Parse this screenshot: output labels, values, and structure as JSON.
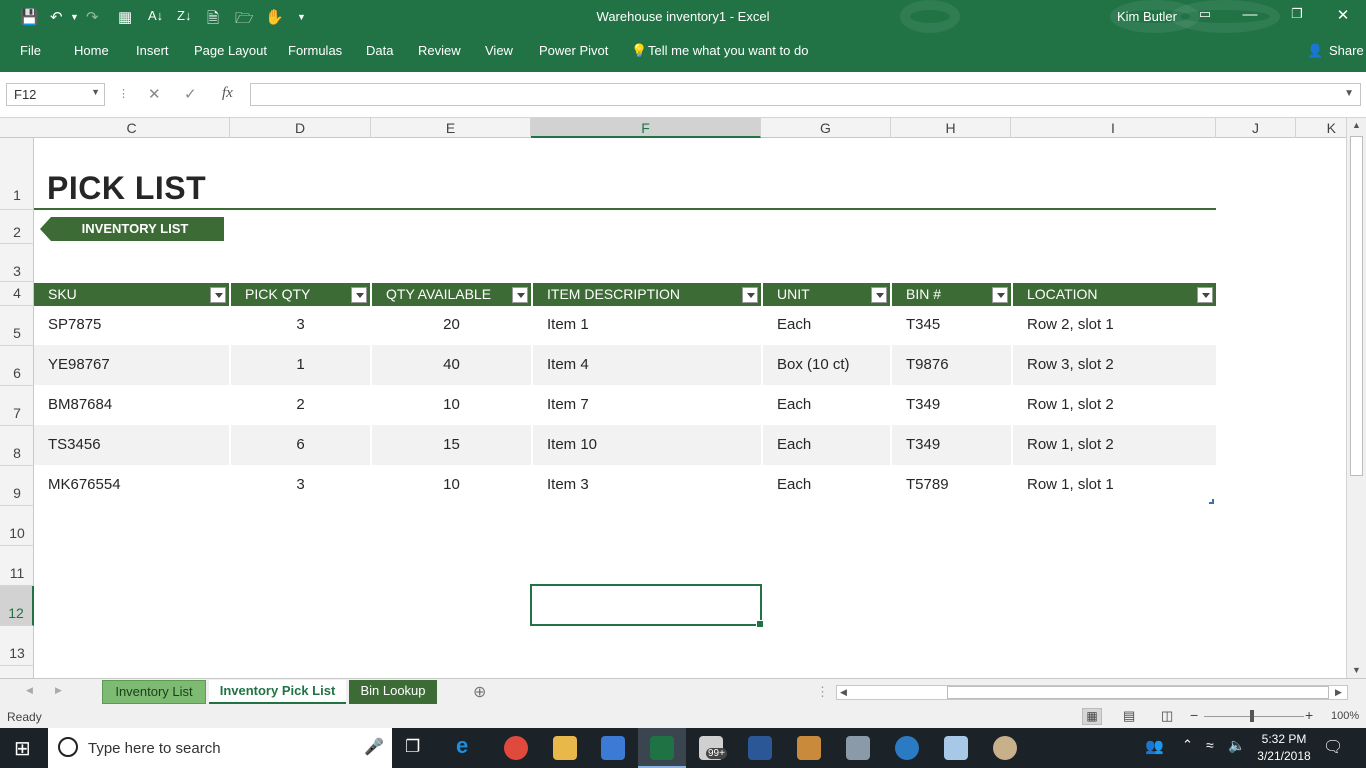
{
  "window": {
    "title": "Warehouse inventory1  -  Excel",
    "user": "Kim Butler",
    "share": "Share"
  },
  "ribbon": {
    "tabs": [
      "File",
      "Home",
      "Insert",
      "Page Layout",
      "Formulas",
      "Data",
      "Review",
      "View",
      "Power Pivot"
    ],
    "tell_me": "Tell me what you want to do"
  },
  "formula_bar": {
    "name_box": "F12",
    "fx": "fx",
    "value": ""
  },
  "columns": [
    "C",
    "D",
    "E",
    "F",
    "G",
    "H",
    "I",
    "J",
    "K"
  ],
  "rows": [
    "1",
    "2",
    "3",
    "4",
    "5",
    "6",
    "7",
    "8",
    "9",
    "10",
    "11",
    "12",
    "13"
  ],
  "sheet": {
    "title": "PICK LIST",
    "nav_button": "INVENTORY LIST",
    "headers": [
      "SKU",
      "PICK QTY",
      "QTY AVAILABLE",
      "ITEM DESCRIPTION",
      "UNIT",
      "BIN #",
      "LOCATION"
    ],
    "table": [
      [
        "SP7875",
        "3",
        "20",
        "Item 1",
        "Each",
        "T345",
        "Row 2, slot 1"
      ],
      [
        "YE98767",
        "1",
        "40",
        "Item 4",
        "Box (10 ct)",
        "T9876",
        "Row 3, slot 2"
      ],
      [
        "BM87684",
        "2",
        "10",
        "Item 7",
        "Each",
        "T349",
        "Row 1, slot 2"
      ],
      [
        "TS3456",
        "6",
        "15",
        "Item 10",
        "Each",
        "T349",
        "Row 1, slot 2"
      ],
      [
        "MK676554",
        "3",
        "10",
        "Item 3",
        "Each",
        "T5789",
        "Row 1, slot 1"
      ]
    ]
  },
  "sheet_tabs": [
    "Inventory List",
    "Inventory Pick List",
    "Bin Lookup"
  ],
  "status": {
    "ready": "Ready",
    "zoom": "100%"
  },
  "taskbar": {
    "search_placeholder": "Type here to search",
    "time": "5:32 PM",
    "date": "3/21/2018",
    "badge": "99+"
  },
  "colors": {
    "excel_green": "#217346",
    "table_header": "#3d6b35"
  }
}
